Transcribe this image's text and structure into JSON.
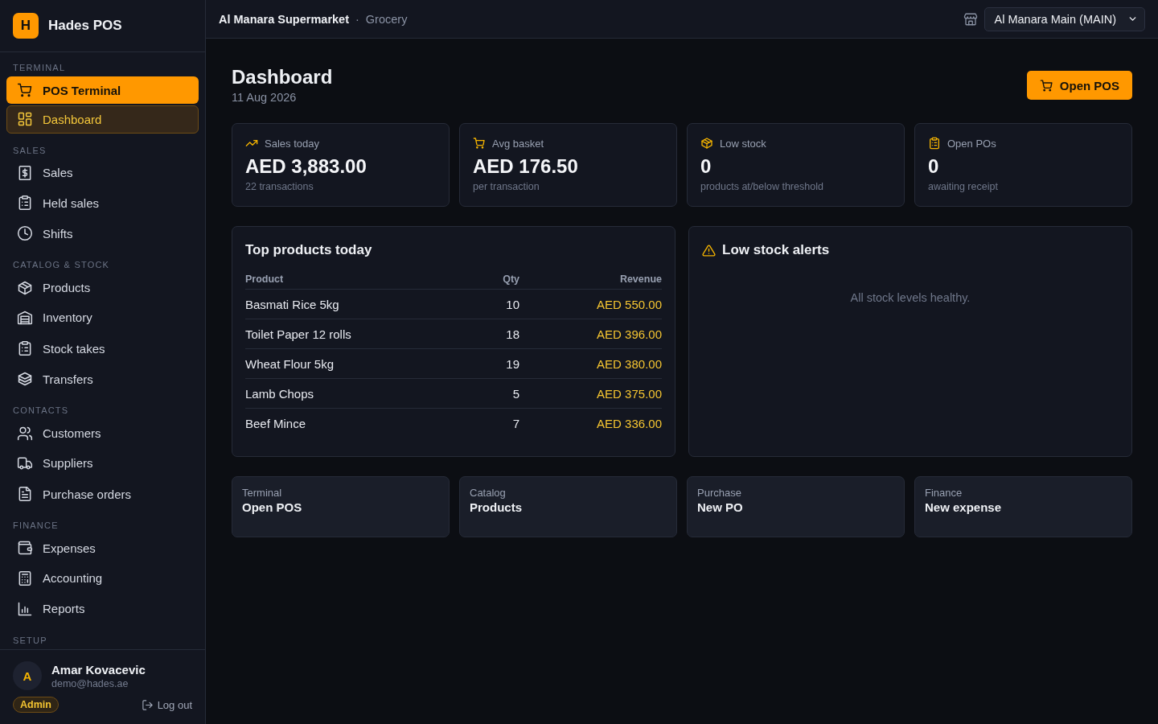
{
  "sidebar": {
    "brand": {
      "logo": "H",
      "name": "Hades POS"
    },
    "sections": [
      {
        "title": "TERMINAL",
        "items": [
          {
            "label": "POS Terminal",
            "kind": "action",
            "selected": false
          },
          {
            "label": "Dashboard",
            "kind": "link",
            "selected": true
          }
        ]
      },
      {
        "title": "SALES",
        "items": [
          {
            "label": "Sales",
            "kind": "link",
            "selected": false
          },
          {
            "label": "Held sales",
            "kind": "link",
            "selected": false
          },
          {
            "label": "Shifts",
            "kind": "link",
            "selected": false
          }
        ]
      },
      {
        "title": "CATALOG & STOCK",
        "items": [
          {
            "label": "Products",
            "kind": "link",
            "selected": false
          },
          {
            "label": "Inventory",
            "kind": "link",
            "selected": false
          },
          {
            "label": "Stock takes",
            "kind": "link",
            "selected": false
          },
          {
            "label": "Transfers",
            "kind": "link",
            "selected": false
          }
        ]
      },
      {
        "title": "CONTACTS",
        "items": [
          {
            "label": "Customers",
            "kind": "link",
            "selected": false
          },
          {
            "label": "Suppliers",
            "kind": "link",
            "selected": false
          },
          {
            "label": "Purchase orders",
            "kind": "link",
            "selected": false
          }
        ]
      },
      {
        "title": "FINANCE",
        "items": [
          {
            "label": "Expenses",
            "kind": "link",
            "selected": false
          },
          {
            "label": "Accounting",
            "kind": "link",
            "selected": false
          },
          {
            "label": "Reports",
            "kind": "link",
            "selected": false
          }
        ]
      },
      {
        "title": "SETUP"
      }
    ],
    "user": {
      "initial": "A",
      "name": "Amar Kovacevic",
      "email": "demo@hades.ae",
      "role": "Admin",
      "logout": "Log out"
    }
  },
  "topbar": {
    "company": "Al Manara Supermarket",
    "separator": "·",
    "category": "Grocery",
    "branch": "Al Manara Main (MAIN)"
  },
  "page": {
    "title": "Dashboard",
    "date": "11 Aug 2026",
    "action": "Open POS"
  },
  "stats": [
    {
      "label": "Sales today",
      "value": "AED 3,883.00",
      "note": "22 transactions"
    },
    {
      "label": "Avg basket",
      "value": "AED 176.50",
      "note": "per transaction"
    },
    {
      "label": "Low stock",
      "value": "0",
      "note": "products at/below threshold"
    },
    {
      "label": "Open POs",
      "value": "0",
      "note": "awaiting receipt"
    }
  ],
  "top_products": {
    "title": "Top products today",
    "columns": [
      "Product",
      "Qty",
      "Revenue"
    ],
    "rows": [
      [
        "Basmati Rice 5kg",
        "10",
        "AED 550.00"
      ],
      [
        "Toilet Paper 12 rolls",
        "18",
        "AED 396.00"
      ],
      [
        "Wheat Flour 5kg",
        "19",
        "AED 380.00"
      ],
      [
        "Lamb Chops",
        "5",
        "AED 375.00"
      ],
      [
        "Beef Mince",
        "7",
        "AED 336.00"
      ]
    ]
  },
  "low_stock": {
    "title": "Low stock alerts",
    "empty": "All stock levels healthy."
  },
  "quick_links": [
    {
      "category": "Terminal",
      "label": "Open POS"
    },
    {
      "category": "Catalog",
      "label": "Products"
    },
    {
      "category": "Purchase",
      "label": "New PO"
    },
    {
      "category": "Finance",
      "label": "New expense"
    }
  ]
}
